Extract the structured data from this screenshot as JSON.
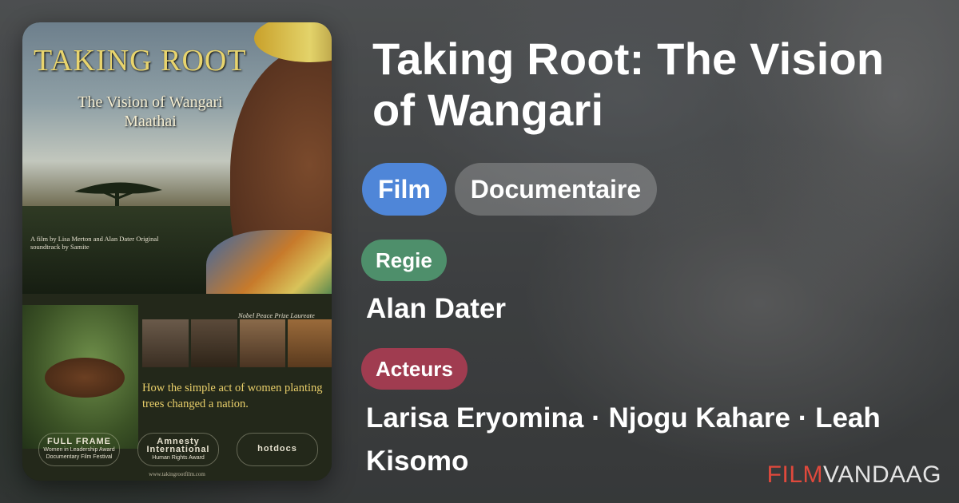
{
  "movie": {
    "title": "Taking Root: The Vision of Wangari",
    "poster": {
      "title_line1": "TAKING ROOT",
      "title_line2": "The Vision of Wangari Maathai",
      "credits": "A film by Lisa Merton and Alan Dater Original soundtrack by Samite",
      "nobel": "Nobel Peace Prize Laureate",
      "tagline": "How the simple act of women planting trees changed a nation.",
      "laurels": [
        {
          "top": "FULL FRAME",
          "sub": "Women in Leadership Award Documentary Film Festival"
        },
        {
          "top": "Amnesty International",
          "sub": "Human Rights Award"
        },
        {
          "top": "hotdocs",
          "sub": ""
        }
      ],
      "url": "www.takingrootfilm.com"
    }
  },
  "tags": {
    "type": "Film",
    "genre": "Documentaire"
  },
  "sections": {
    "director_label": "Regie",
    "director": "Alan Dater",
    "actors_label": "Acteurs",
    "actors": "Larisa Eryomina · Njogu Kahare · Leah Kisomo"
  },
  "brand": {
    "part1": "FILM",
    "part2": "VANDAAG"
  },
  "colors": {
    "film_tag": "#4f86d8",
    "regie_label": "#4e8f6b",
    "acteurs_label": "#a03c50",
    "brand_accent": "#e0493c"
  }
}
